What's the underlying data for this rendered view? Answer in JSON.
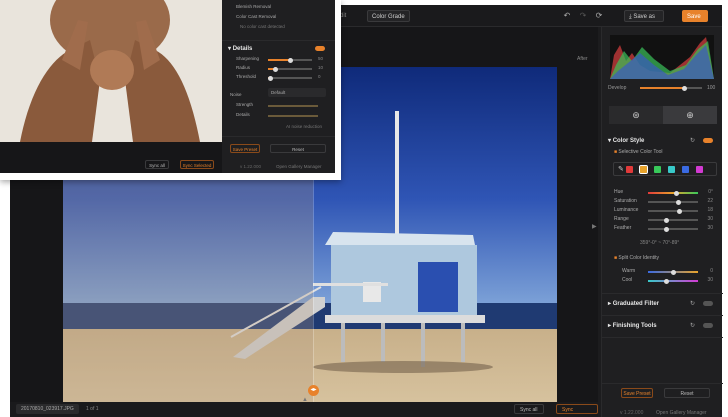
{
  "topbar": {
    "tab_color_grade": "Color Grade",
    "tab_prev": "Edit",
    "export_label": "Save as",
    "save_label": "Save",
    "undo_icon": "undo-icon",
    "redo_icon": "redo-icon",
    "reset_icon": "reset-icon"
  },
  "canvas": {
    "before_label": "After",
    "file_name": "20170810_023917.JPG",
    "page_indicator": "1 of 1",
    "sync_all": "Sync all",
    "sync_selected": "Sync Selected"
  },
  "right_panel": {
    "hist_label": "Develop",
    "hist_value": "100",
    "color_style": {
      "title": "Color Style",
      "subtitle": "Selective Color Tool",
      "swatches": [
        "#e23a3a",
        "#e8a32b",
        "#38c95a",
        "#38c9c9",
        "#3a6ae2",
        "#d23ad2"
      ],
      "rows": [
        {
          "label": "Hue",
          "value": "0°"
        },
        {
          "label": "Saturation",
          "value": "22"
        },
        {
          "label": "Luminance",
          "value": "18"
        },
        {
          "label": "Range",
          "value": "30"
        },
        {
          "label": "Feather",
          "value": "30"
        }
      ],
      "range_text": "359°-0° ~ 70°-89°",
      "split_title": "Split Color Identity",
      "split_rows": [
        {
          "label": "Warm",
          "value": "0"
        },
        {
          "label": "Cool",
          "value": "30"
        }
      ]
    },
    "graduated_filter": "Graduated Filter",
    "finishing_tools": "Finishing Tools",
    "save_preset": "Save Preset",
    "reset": "Reset",
    "footer_version": "v 1.22.000",
    "footer_link": "Open Gallery Manager"
  },
  "popup": {
    "top_rows": [
      {
        "label": "Blemish Removal"
      },
      {
        "label": "Color Cast Removal"
      },
      {
        "label": "No color cast detected"
      }
    ],
    "details_title": "Details",
    "details_rows": [
      {
        "label": "Sharpening",
        "value": "50"
      },
      {
        "label": "Radius",
        "value": "10"
      },
      {
        "label": "Threshold",
        "value": "0"
      }
    ],
    "noise_label": "Noise",
    "noise_value": "Default",
    "noise_rows": [
      {
        "label": "Strength"
      },
      {
        "label": "Details"
      }
    ],
    "noise_note": "AI noise reduction",
    "save_preset": "Save Preset",
    "reset": "Reset",
    "sync_all": "Sync all",
    "sync_selected": "Sync Selected",
    "footer_version": "v 1.22.000",
    "footer_link": "Open Gallery Manager"
  },
  "colors": {
    "accent": "#e8822b",
    "panel": "#1f1f21",
    "canvas": "#161618"
  }
}
